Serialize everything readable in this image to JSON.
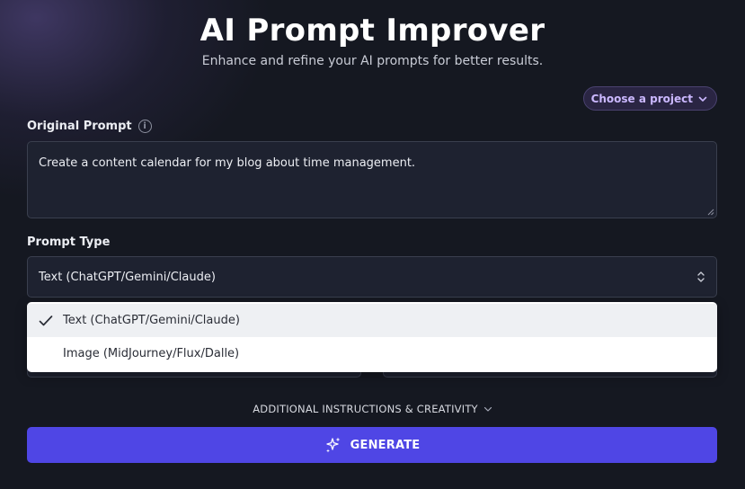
{
  "header": {
    "title": "AI Prompt Improver",
    "subtitle": "Enhance and refine your AI prompts for better results."
  },
  "project_selector": {
    "label": "Choose a project",
    "icon": "chevron-down-icon"
  },
  "original_prompt": {
    "label": "Original Prompt",
    "info_icon": "info-icon",
    "value": "Create a content calendar for my blog about time management."
  },
  "prompt_type": {
    "label": "Prompt Type",
    "selected": "Text (ChatGPT/Gemini/Claude)",
    "options": [
      {
        "label": "Text (ChatGPT/Gemini/Claude)",
        "selected": true
      },
      {
        "label": "Image (MidJourney/Flux/Dalle)",
        "selected": false
      }
    ]
  },
  "additional": {
    "label": "ADDITIONAL INSTRUCTIONS & CREATIVITY",
    "icon": "chevron-down-icon"
  },
  "generate": {
    "label": "GENERATE",
    "icon": "sparkles-icon"
  },
  "colors": {
    "background": "#151821",
    "accent": "#4f46e5",
    "project_text": "#cbb8ff"
  }
}
